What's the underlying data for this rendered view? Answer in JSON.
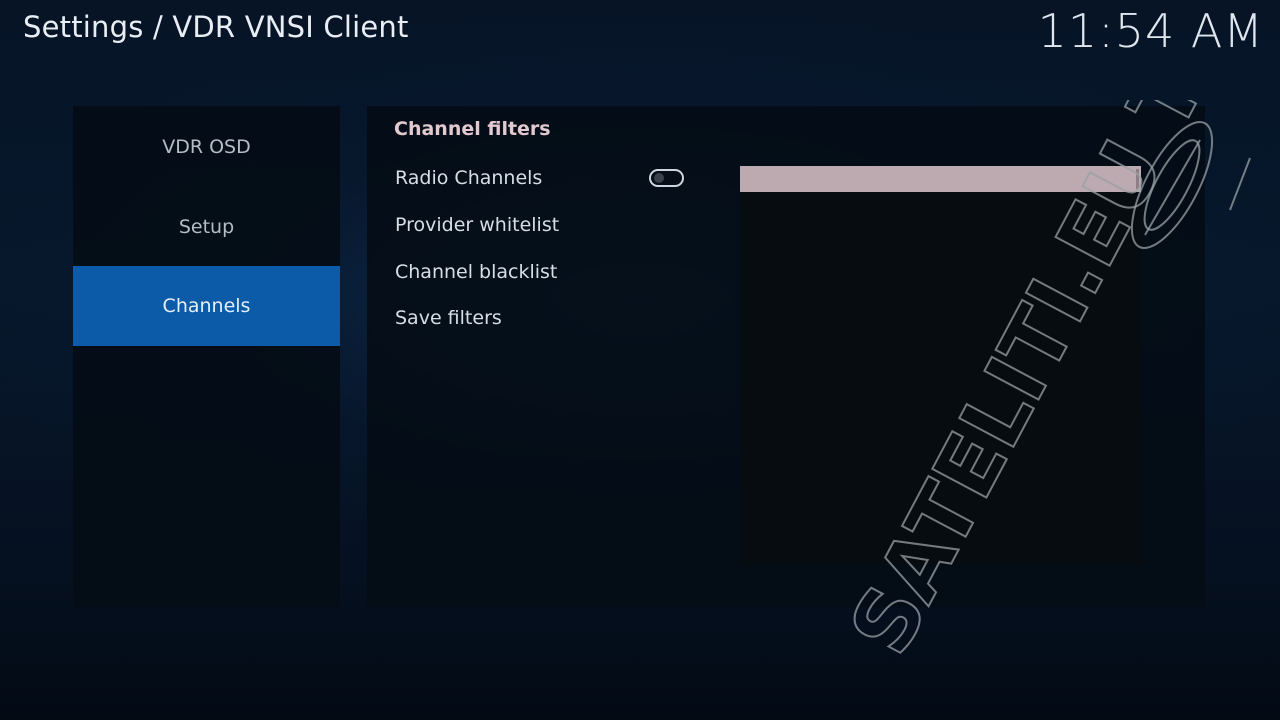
{
  "header": {
    "title": "Settings / VDR VNSI Client",
    "clock": "11:54 AM"
  },
  "categories": [
    {
      "label": "VDR OSD",
      "active": false
    },
    {
      "label": "Setup",
      "active": false
    },
    {
      "label": "Channels",
      "active": true
    }
  ],
  "settings": {
    "group_title": "Channel filters",
    "items": [
      {
        "label": "Radio Channels",
        "type": "toggle",
        "value": false
      },
      {
        "label": "Provider whitelist",
        "type": "action"
      },
      {
        "label": "Channel blacklist",
        "type": "action"
      },
      {
        "label": "Save filters",
        "type": "action"
      }
    ]
  },
  "watermark": {
    "text": "SATELITI.EU TV",
    "color": "#9aa0a6"
  },
  "colors": {
    "accent": "#0b5ba8",
    "group_header": "#e2c9cf",
    "info_bar": "#bcaab0"
  }
}
